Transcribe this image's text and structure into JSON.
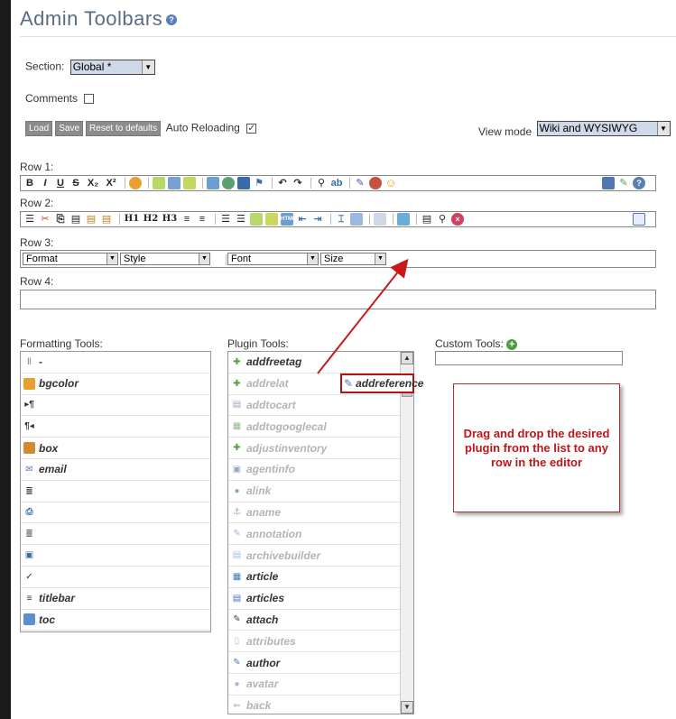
{
  "page": {
    "title": "Admin Toolbars",
    "help_icon": "help-icon"
  },
  "section": {
    "label": "Section:",
    "value": "Global *"
  },
  "comments": {
    "label": "Comments"
  },
  "actions": {
    "load": "Load",
    "save": "Save",
    "reset": "Reset to defaults",
    "auto_reload_label": "Auto Reloading",
    "auto_reload_checked": true
  },
  "view_mode": {
    "label": "View mode",
    "value": "Wiki and WYSIWYG"
  },
  "rows": {
    "row1": "Row 1:",
    "row2": "Row 2:",
    "row3": "Row 3:",
    "row4": "Row 4:"
  },
  "row3_selects": {
    "format": "Format",
    "style": "Style",
    "font": "Font",
    "size": "Size"
  },
  "formatting_tools": {
    "heading": "Formatting Tools:",
    "items": [
      {
        "label": "-",
        "icon": "separator-icon"
      },
      {
        "label": "bgcolor",
        "icon": "color-palette-icon"
      },
      {
        "label": "",
        "icon": "ltr-paragraph-icon"
      },
      {
        "label": "",
        "icon": "rtl-paragraph-icon"
      },
      {
        "label": "box",
        "icon": "box-icon"
      },
      {
        "label": "email",
        "icon": "email-icon"
      },
      {
        "label": "",
        "icon": "justify-icon"
      },
      {
        "label": "",
        "icon": "print-icon"
      },
      {
        "label": "",
        "icon": "indent-icon"
      },
      {
        "label": "",
        "icon": "select-all-icon"
      },
      {
        "label": "",
        "icon": "spellcheck-icon"
      },
      {
        "label": "titlebar",
        "icon": "titlebar-icon"
      },
      {
        "label": "toc",
        "icon": "toc-icon"
      }
    ]
  },
  "plugin_tools": {
    "heading": "Plugin Tools:",
    "items": [
      {
        "label": "addfreetag",
        "dim": false,
        "icon": "puzzle-icon"
      },
      {
        "label": "addrelat",
        "dim": true,
        "icon": "puzzle-icon"
      },
      {
        "label": "addtocart",
        "dim": true,
        "icon": "cart-icon"
      },
      {
        "label": "addtogooglecal",
        "dim": true,
        "icon": "calendar-icon"
      },
      {
        "label": "adjustinventory",
        "dim": true,
        "icon": "puzzle-icon"
      },
      {
        "label": "agentinfo",
        "dim": true,
        "icon": "agent-icon"
      },
      {
        "label": "alink",
        "dim": true,
        "icon": "link-icon"
      },
      {
        "label": "aname",
        "dim": true,
        "icon": "anchor-icon"
      },
      {
        "label": "annotation",
        "dim": true,
        "icon": "annotation-icon"
      },
      {
        "label": "archivebuilder",
        "dim": true,
        "icon": "archive-icon"
      },
      {
        "label": "article",
        "dim": false,
        "icon": "article-icon"
      },
      {
        "label": "articles",
        "dim": false,
        "icon": "articles-icon"
      },
      {
        "label": "attach",
        "dim": false,
        "icon": "paperclip-icon"
      },
      {
        "label": "attributes",
        "dim": true,
        "icon": "attributes-icon"
      },
      {
        "label": "author",
        "dim": false,
        "icon": "author-icon"
      },
      {
        "label": "avatar",
        "dim": true,
        "icon": "avatar-icon"
      },
      {
        "label": "back",
        "dim": true,
        "icon": "back-arrow-icon"
      }
    ]
  },
  "dragged_plugin": "addreference",
  "custom_tools": {
    "heading": "Custom Tools:"
  },
  "callout": {
    "text": "Drag and drop the desired plugin from the list to any row in the editor"
  }
}
